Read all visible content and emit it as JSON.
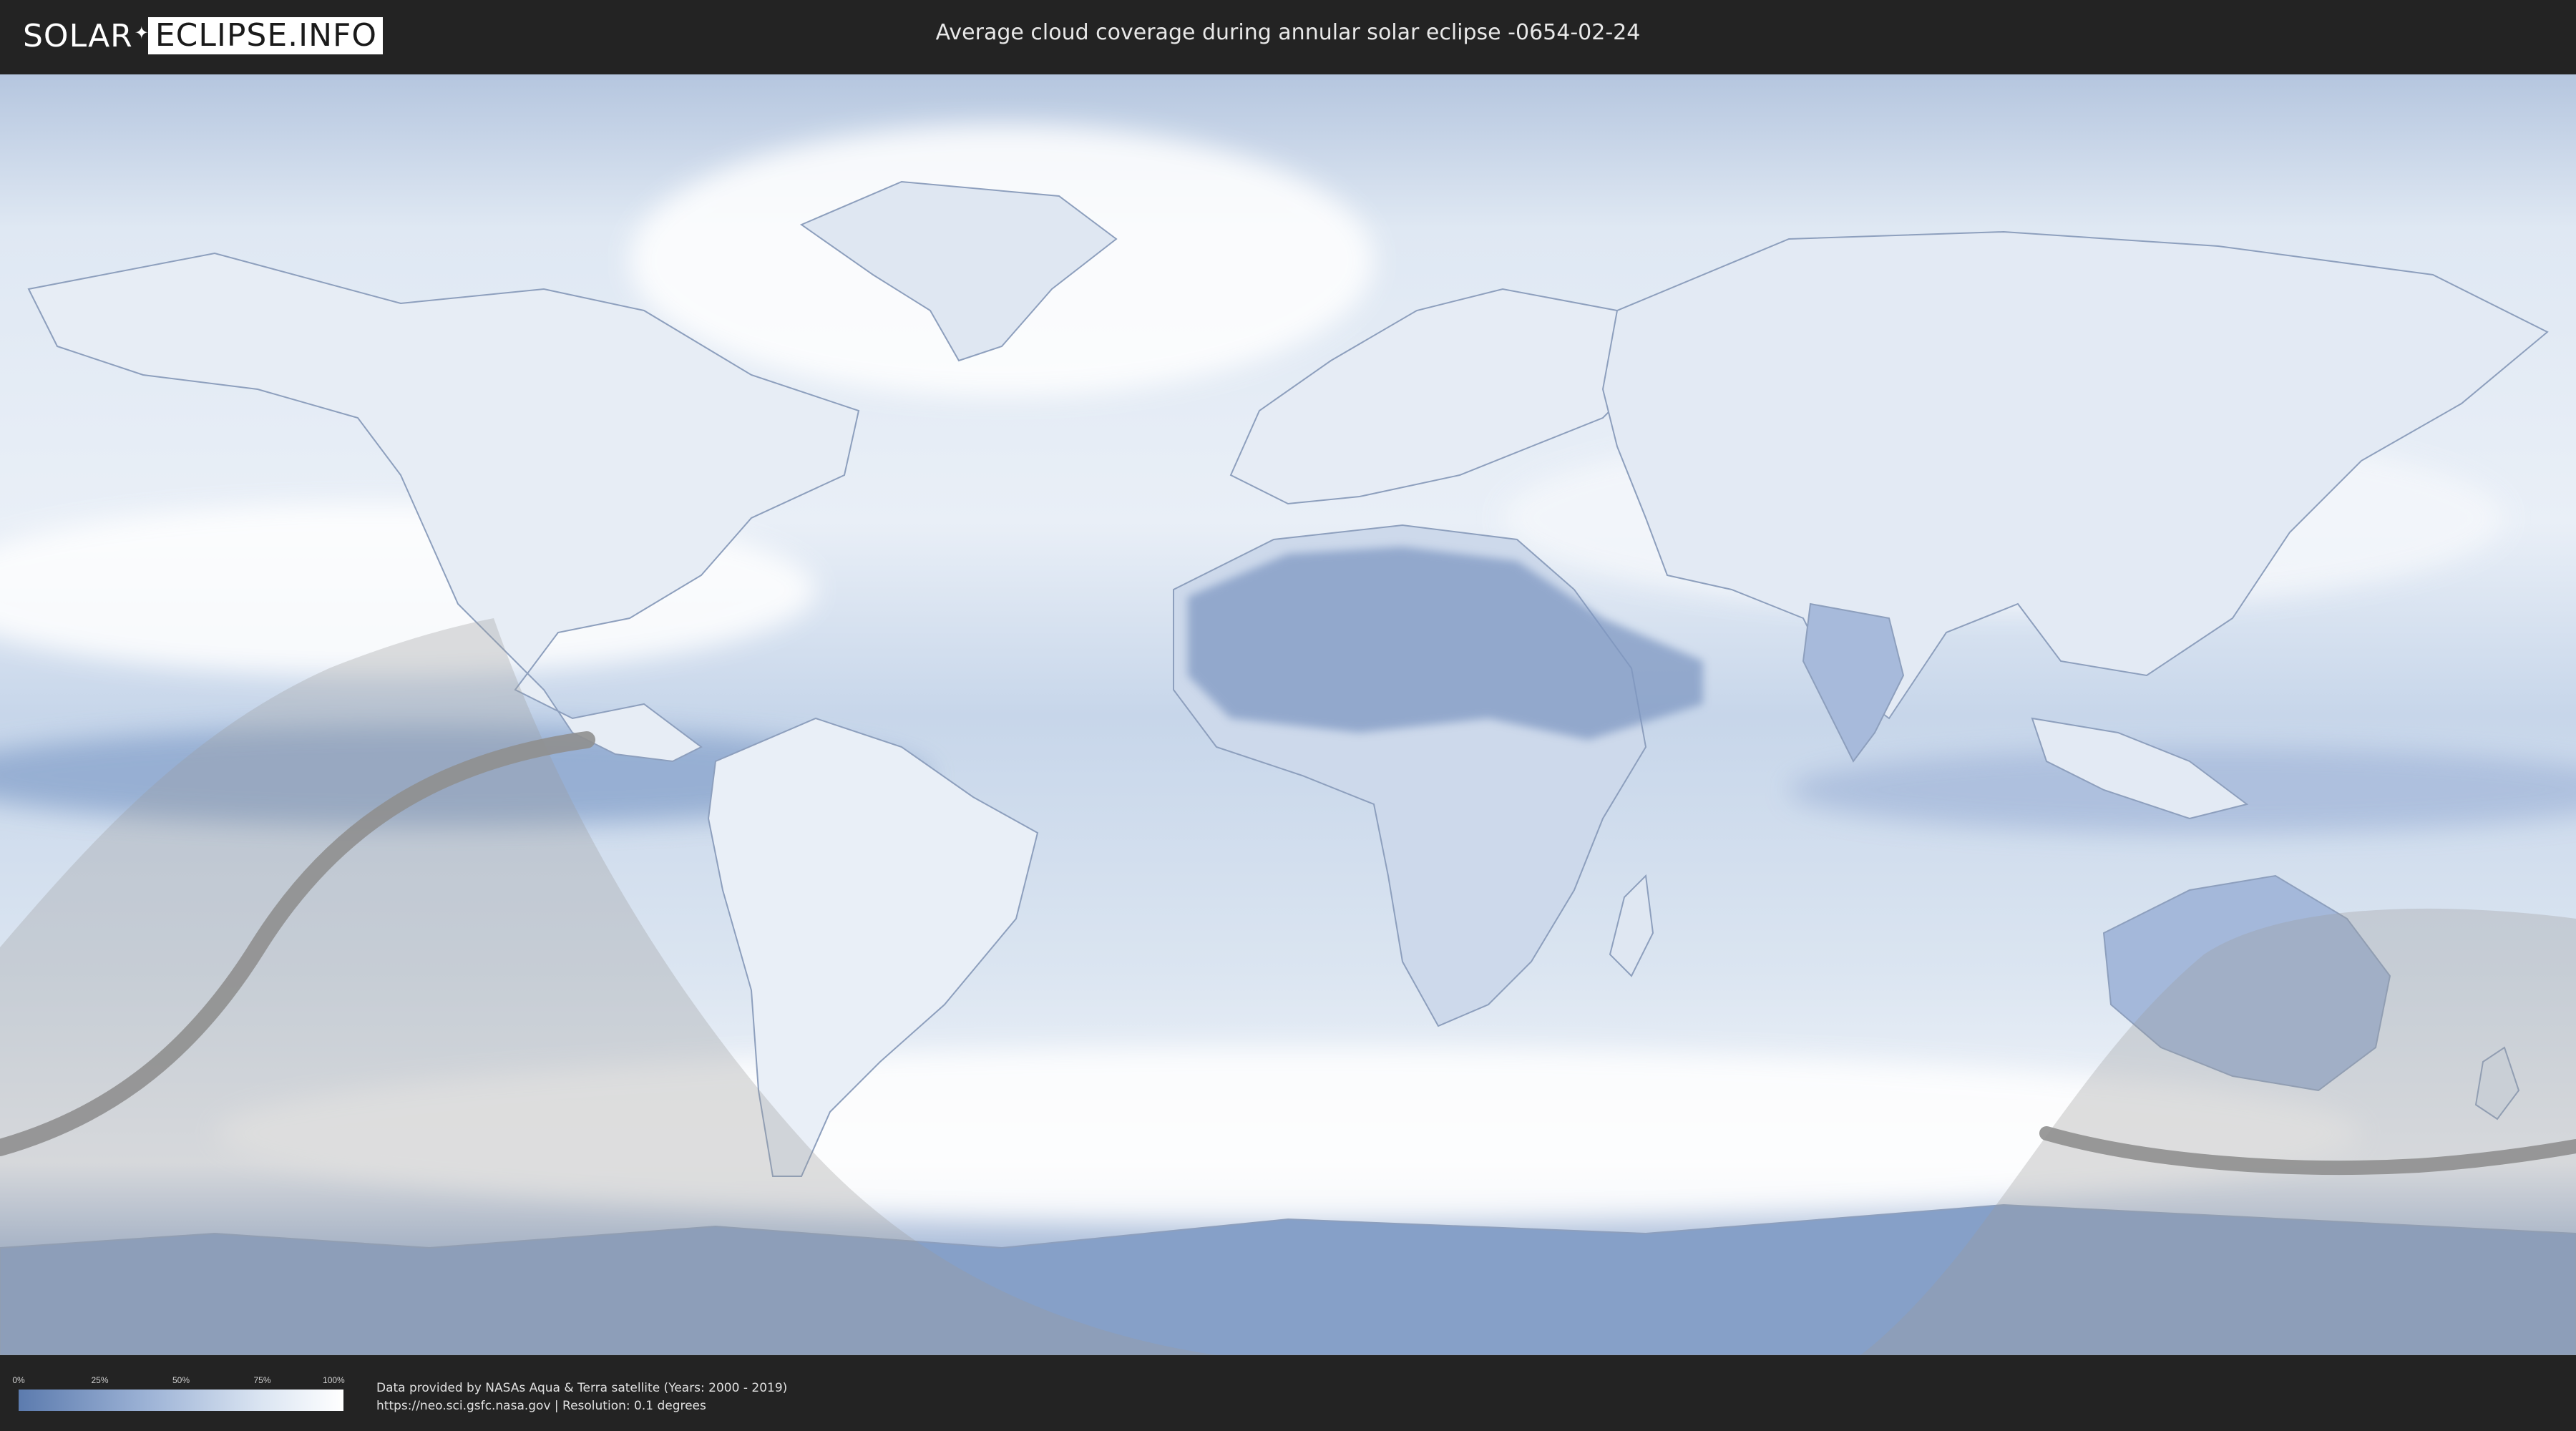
{
  "header": {
    "logo_left": "SOLAR",
    "logo_right": "ECLIPSE.INFO",
    "title": "Average cloud coverage during annular solar eclipse -0654-02-24"
  },
  "legend": {
    "ticks": [
      "0%",
      "25%",
      "50%",
      "75%",
      "100%"
    ],
    "gradient_colors": [
      "#5c7bae",
      "#9db3d6",
      "#dbe5f2",
      "#ffffff"
    ]
  },
  "footer": {
    "credit_line1": "Data provided by NASAs Aqua & Terra satellite (Years: 2000 - 2019)",
    "credit_line2": "https://neo.sci.gsfc.nasa.gov | Resolution: 0.1 degrees"
  },
  "map": {
    "ocean_color": "#c9d7ea",
    "land_color": "#e7edf5",
    "dry_region_color": "#7f98c2",
    "night_shade_color": "#9a9a9a",
    "eclipse_path_color": "#8f8f8f"
  }
}
